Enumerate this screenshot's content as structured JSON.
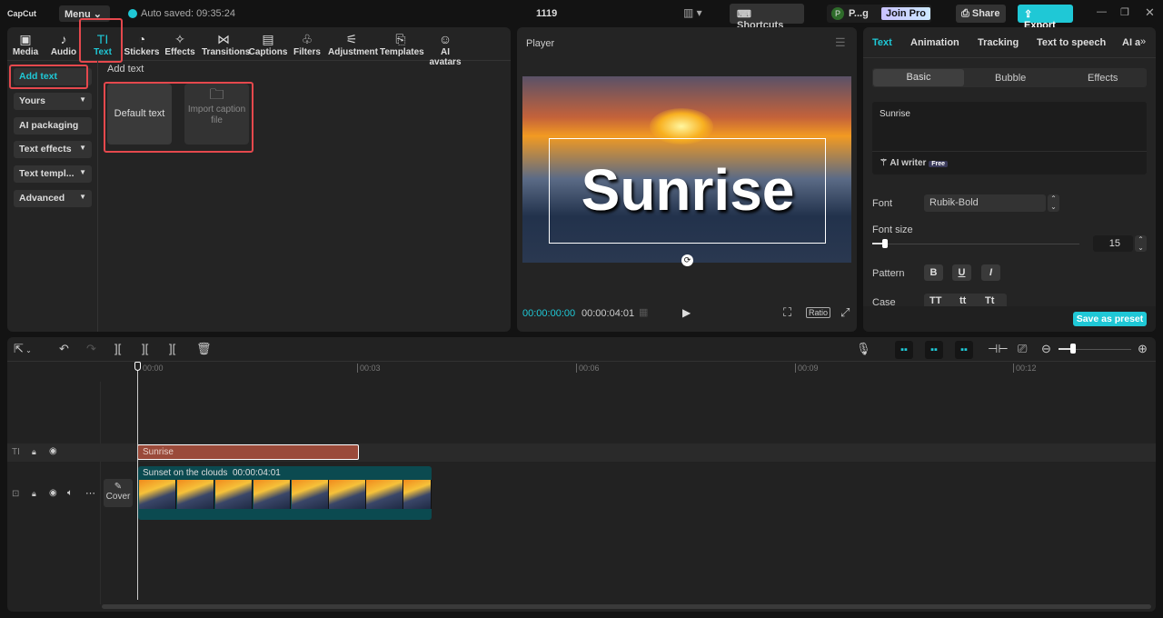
{
  "app": {
    "logo": "CapCut",
    "menu": "Menu",
    "autosave": "Auto saved: 09:35:24",
    "project": "1119",
    "shortcuts": "Shortcuts",
    "user_initial": "P",
    "user_name": "P...g",
    "join_pro": "Join Pro",
    "share": "Share",
    "export": "Export"
  },
  "tools": [
    {
      "label": "Media",
      "icon": "▣"
    },
    {
      "label": "Audio",
      "icon": "♪"
    },
    {
      "label": "Text",
      "icon": "TI"
    },
    {
      "label": "Stickers",
      "icon": "◔"
    },
    {
      "label": "Effects",
      "icon": "✧"
    },
    {
      "label": "Transitions",
      "icon": "⋈"
    },
    {
      "label": "Captions",
      "icon": "▤"
    },
    {
      "label": "Filters",
      "icon": "♧"
    },
    {
      "label": "Adjustment",
      "icon": "⚟"
    },
    {
      "label": "Templates",
      "icon": "⎘"
    },
    {
      "label": "AI avatars",
      "icon": "☺"
    }
  ],
  "sidebar": [
    {
      "label": "Add text"
    },
    {
      "label": "Yours"
    },
    {
      "label": "AI packaging"
    },
    {
      "label": "Text effects"
    },
    {
      "label": "Text templ..."
    },
    {
      "label": "Advanced"
    }
  ],
  "content": {
    "heading": "Add text",
    "default_text": "Default text",
    "import_caption": "Import caption file"
  },
  "player": {
    "title": "Player",
    "overlay_text": "Sunrise",
    "current_time": "00:00:00:00",
    "total_time": "00:00:04:01",
    "ratio": "Ratio"
  },
  "inspector": {
    "tabs": [
      "Text",
      "Animation",
      "Tracking",
      "Text to speech",
      "AI avat"
    ],
    "subtabs": [
      "Basic",
      "Bubble",
      "Effects"
    ],
    "text_value": "Sunrise",
    "ai_writer": "AI writer",
    "free": "Free",
    "font_label": "Font",
    "font_value": "Rubik-Bold",
    "font_size_label": "Font size",
    "font_size": "15",
    "font_size_fraction": 0.03,
    "pattern_label": "Pattern",
    "case_label": "Case",
    "case_options": [
      "TT",
      "tt",
      "Tt"
    ],
    "save_preset": "Save as preset"
  },
  "timeline": {
    "ticks": [
      "00:00",
      "00:03",
      "00:06",
      "00:09",
      "00:12"
    ],
    "text_clip": "Sunrise",
    "video_clip": "Sunset on the clouds",
    "video_duration": "00:00:04:01",
    "cover": "Cover",
    "zoom_fraction": 0.2
  },
  "colors": {
    "accent": "#1fc8d6",
    "highlight": "#e5484d",
    "text_clip": "#9a4a3a",
    "video_clip": "#0b4a50"
  }
}
